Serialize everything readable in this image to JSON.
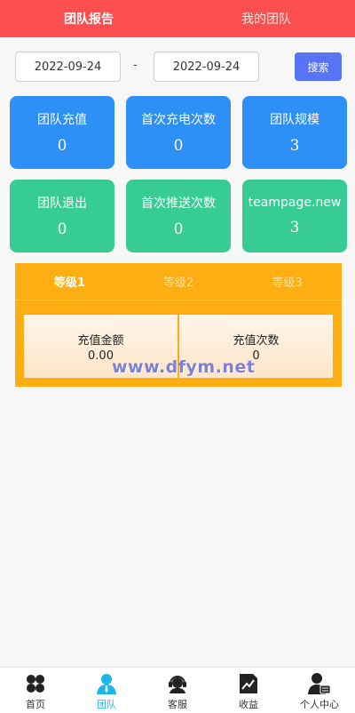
{
  "top_tabs": {
    "team_report": "团队报告",
    "my_team": "我的团队"
  },
  "filters": {
    "start_date": "2022-09-24",
    "separator": "-",
    "end_date": "2022-09-24",
    "search_label": "搜索"
  },
  "stats": [
    {
      "label": "团队充值",
      "value": "0",
      "color": "#2e8ff7"
    },
    {
      "label": "首次充电次数",
      "value": "0",
      "color": "#2e8ff7"
    },
    {
      "label": "团队规模",
      "value": "3",
      "color": "#2e8ff7"
    },
    {
      "label": "团队退出",
      "value": "0",
      "color": "#36cc94"
    },
    {
      "label": "首次推送次数",
      "value": "0",
      "color": "#36cc94"
    },
    {
      "label": "teampage.new",
      "value": "3",
      "color": "#36cc94"
    }
  ],
  "levels": {
    "tabs": [
      "等级1",
      "等级2",
      "等级3"
    ],
    "accent": "#fdae12",
    "cells": [
      {
        "label": "充值金额",
        "value": "0.00"
      },
      {
        "label": "充值次数",
        "value": "0"
      }
    ]
  },
  "watermark": "www.dfym.net",
  "bottom_nav": [
    {
      "label": "首页",
      "icon": "home-grid-icon"
    },
    {
      "label": "团队",
      "icon": "team-person-icon"
    },
    {
      "label": "客服",
      "icon": "headset-icon"
    },
    {
      "label": "收益",
      "icon": "chart-doc-icon"
    },
    {
      "label": "个人中心",
      "icon": "user-card-icon"
    }
  ]
}
